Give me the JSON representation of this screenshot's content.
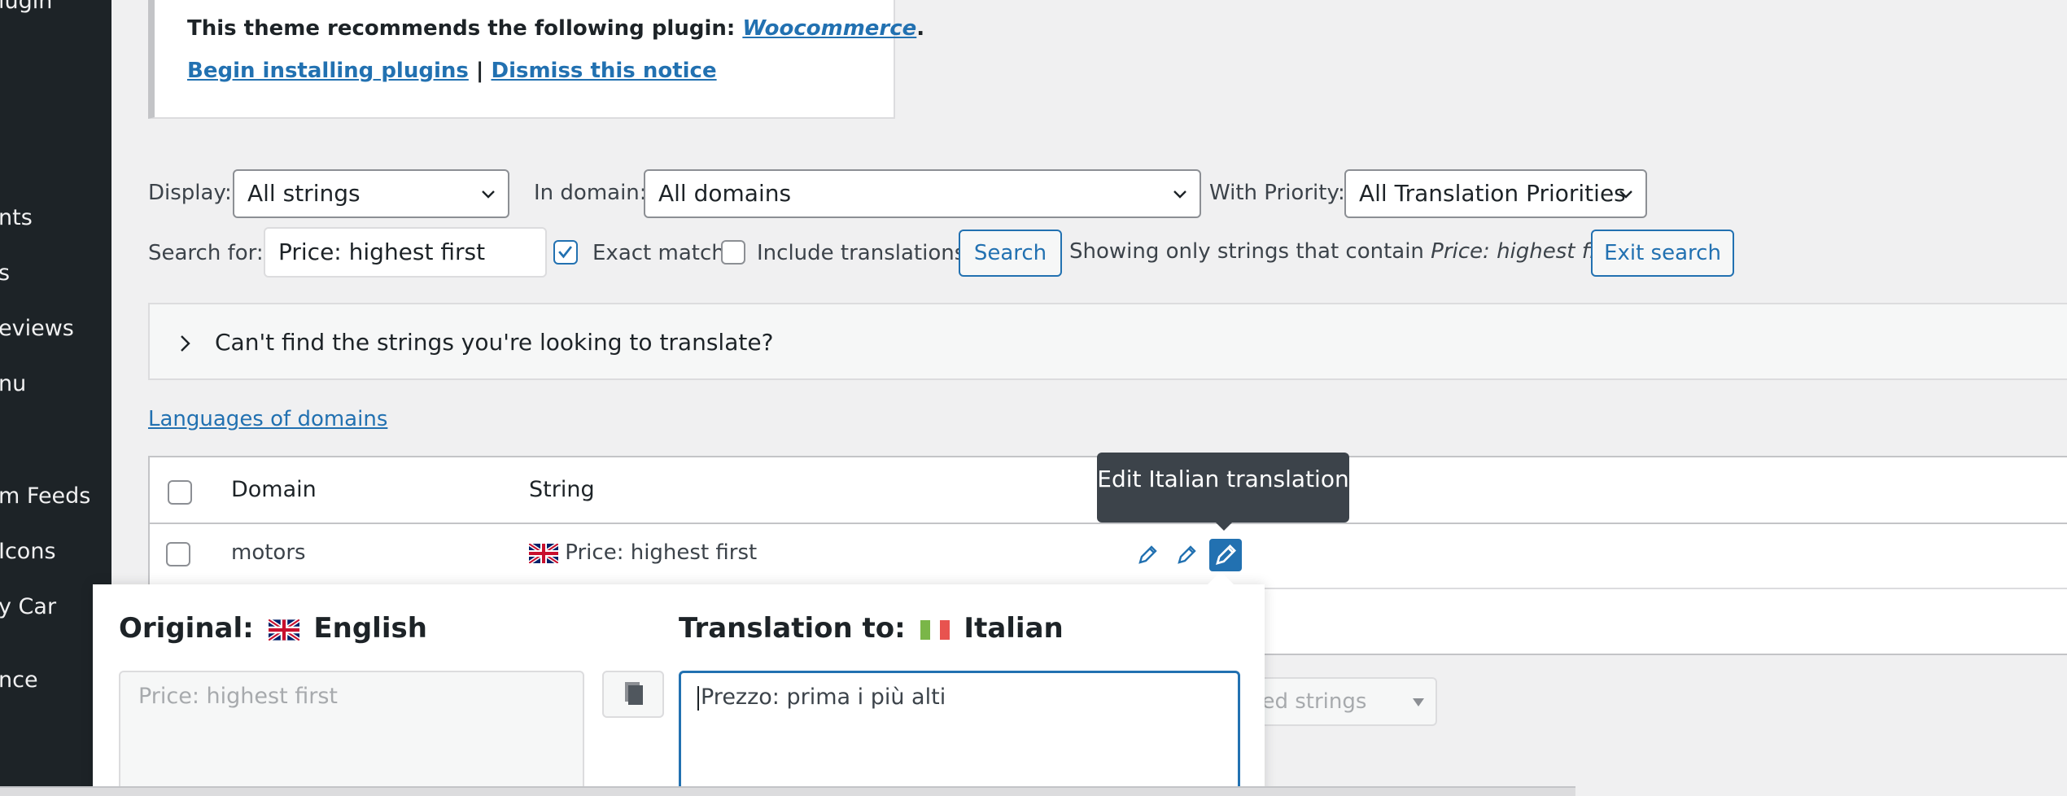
{
  "sidebar": {
    "items": [
      {
        "label": "lugin"
      },
      {
        "label": "nts"
      },
      {
        "label": "s"
      },
      {
        "label": "eviews"
      },
      {
        "label": "nu"
      },
      {
        "label": "m Feeds"
      },
      {
        "label": "Icons"
      },
      {
        "label": "y Car"
      },
      {
        "label": "nce"
      }
    ]
  },
  "notice": {
    "text_prefix": "This theme recommends the following plugin: ",
    "plugin_link": "Woocommerce",
    "text_suffix": ".",
    "install_link": "Begin installing plugins",
    "separator": "|",
    "dismiss_link": "Dismiss this notice"
  },
  "filters": {
    "display_label": "Display:",
    "display_value": "All strings",
    "domain_label": "In domain:",
    "domain_value": "All domains",
    "priority_label": "With Priority:",
    "priority_value": "All Translation Priorities",
    "search_label": "Search for:",
    "search_value": "Price: highest first",
    "exact_match_label": "Exact match",
    "exact_match_checked": true,
    "include_translations_label": "Include translations",
    "include_translations_checked": false,
    "search_button": "Search",
    "showing_prefix": "Showing only strings that contain ",
    "showing_term": "Price: highest first",
    "exit_search_button": "Exit search"
  },
  "cant_find": {
    "text": "Can't find the strings you're looking to translate?"
  },
  "languages_link": "Languages of domains",
  "table": {
    "columns": {
      "domain": "Domain",
      "string": "String"
    },
    "rows": [
      {
        "domain": "motors",
        "string": "Price: highest first",
        "flag": "uk-flag-icon"
      }
    ]
  },
  "tooltip": {
    "text": "Edit Italian translation"
  },
  "bulk_select": {
    "text": "cted strings"
  },
  "popup": {
    "original_label": "Original:",
    "original_lang": "English",
    "translation_label": "Translation to:",
    "translation_lang": "Italian",
    "original_text": "Price: highest first",
    "translation_text": "Prezzo: prima i più alti"
  },
  "colors": {
    "sidebar_bg": "#1d2327",
    "accent": "#2271b1",
    "page_bg": "#f0f0f1",
    "tooltip_bg": "#3c434a"
  }
}
